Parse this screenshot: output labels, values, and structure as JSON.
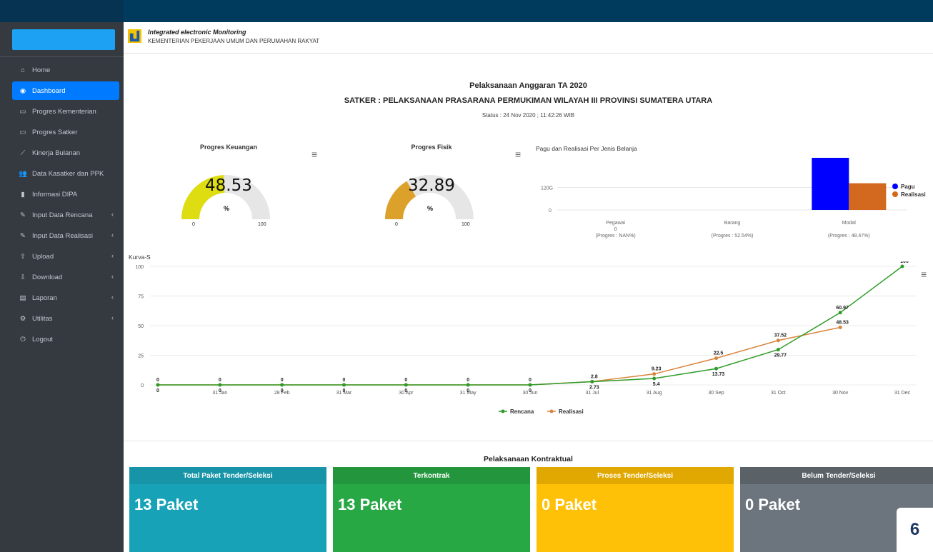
{
  "sidebar": {
    "items": [
      {
        "label": "Home",
        "icon": "home-icon"
      },
      {
        "label": "Dashboard",
        "icon": "dashboard-icon",
        "active": true
      },
      {
        "label": "Progres Kementerian",
        "icon": "monitor-icon"
      },
      {
        "label": "Progres Satker",
        "icon": "monitor-icon"
      },
      {
        "label": "Kinerja Bulanan",
        "icon": "line-chart-icon"
      },
      {
        "label": "Data Kasatker dan PPK",
        "icon": "users-icon"
      },
      {
        "label": "Informasi DIPA",
        "icon": "file-icon"
      },
      {
        "label": "Input Data Rencana",
        "icon": "edit-icon",
        "has_children": true
      },
      {
        "label": "Input Data Realisasi",
        "icon": "edit-icon",
        "has_children": true
      },
      {
        "label": "Upload",
        "icon": "upload-icon",
        "has_children": true
      },
      {
        "label": "Download",
        "icon": "download-icon",
        "has_children": true
      },
      {
        "label": "Laporan",
        "icon": "file-text-icon",
        "has_children": true
      },
      {
        "label": "Utilitas",
        "icon": "cog-icon",
        "has_children": true
      },
      {
        "label": "Logout",
        "icon": "power-icon"
      }
    ]
  },
  "header": {
    "app_name": "Integrated electronic Monitoring",
    "org_name": "KEMENTERIAN PEKERJAAN UMUM DAN PERUMAHAN RAKYAT"
  },
  "main": {
    "title": "Pelaksanaan Anggaran TA 2020",
    "subtitle": "SATKER : PELAKSANAAN PRASARANA PERMUKIMAN WILAYAH III PROVINSI SUMATERA UTARA",
    "status": "Status : 24 Nov 2020 ; 11:42:26 WIB"
  },
  "gauges": [
    {
      "title": "Progres Keuangan",
      "value": "48.53",
      "unit": "%",
      "min": "0",
      "max": "100",
      "fraction": 0.4853,
      "color": "#dddd11"
    },
    {
      "title": "Progres Fisik",
      "value": "32.89",
      "unit": "%",
      "min": "0",
      "max": "100",
      "fraction": 0.3289,
      "color": "#dca12a"
    }
  ],
  "bar_panel": {
    "title": "Pagu dan Realisasi Per Jenis Belanja",
    "y_ticks": [
      "120G",
      "0"
    ],
    "categories": [
      {
        "name": "Pegawai",
        "line2": "0",
        "line3": "(Progres : NAN%)"
      },
      {
        "name": "Barang",
        "line2": "",
        "line3": "(Progres : 52.54%)"
      },
      {
        "name": "Modal",
        "line2": "",
        "line3": "(Progres : 48.47%)"
      }
    ]
  },
  "kurva": {
    "title": "Kurva-S",
    "menu_icon": "hamburger-icon"
  },
  "kontraktual": {
    "title": "Pelaksanaan Kontraktual",
    "cards": [
      {
        "header": "Total Paket Tender/Seleksi",
        "value": "13 Paket",
        "header_color": "#1794a8",
        "body_color": "#17a2b8"
      },
      {
        "header": "Terkontrak",
        "value": "13 Paket",
        "header_color": "#23963d",
        "body_color": "#28a745"
      },
      {
        "header": "Proses Tender/Seleksi",
        "value": "0 Paket",
        "header_color": "#e0a800",
        "body_color": "#ffc107"
      },
      {
        "header": "Belum Tender/Seleksi",
        "value": "0 Paket",
        "header_color": "#5a6268",
        "body_color": "#6c757d"
      }
    ]
  },
  "page_number": "6",
  "chart_data": [
    {
      "type": "bar",
      "title": "Pagu dan Realisasi Per Jenis Belanja",
      "categories": [
        "Pegawai",
        "Barang",
        "Modal"
      ],
      "series": [
        {
          "name": "Pagu",
          "color": "#0000ff",
          "values": [
            0,
            0,
            155
          ]
        },
        {
          "name": "Realisasi",
          "color": "#d2691e",
          "values": [
            0,
            0,
            75
          ]
        }
      ],
      "y_ticks": [
        "0",
        "120G"
      ],
      "ylim": [
        0,
        240
      ],
      "legend": "top-right"
    },
    {
      "type": "line",
      "title": "Kurva-S",
      "categories": [
        "",
        "31 Jan",
        "28 Feb",
        "31 Mar",
        "30 Apr",
        "31 May",
        "30 Jun",
        "31 Jul",
        "31 Aug",
        "30 Sep",
        "31 Oct",
        "30 Nov",
        "31 Dec"
      ],
      "ylim": [
        0,
        100
      ],
      "y_ticks": [
        0,
        25,
        50,
        75,
        100
      ],
      "series": [
        {
          "name": "Rencana",
          "color": "#2e9c28",
          "values": [
            0,
            0,
            0,
            0,
            0,
            0,
            0,
            2.73,
            5.4,
            13.73,
            29.77,
            60.97,
            100
          ]
        },
        {
          "name": "Realisasi",
          "color": "#d8843a",
          "values": [
            0,
            0,
            0,
            0,
            0,
            0,
            0,
            2.8,
            9.23,
            22.5,
            37.52,
            48.53,
            null
          ]
        }
      ],
      "legend": "bottom"
    }
  ]
}
